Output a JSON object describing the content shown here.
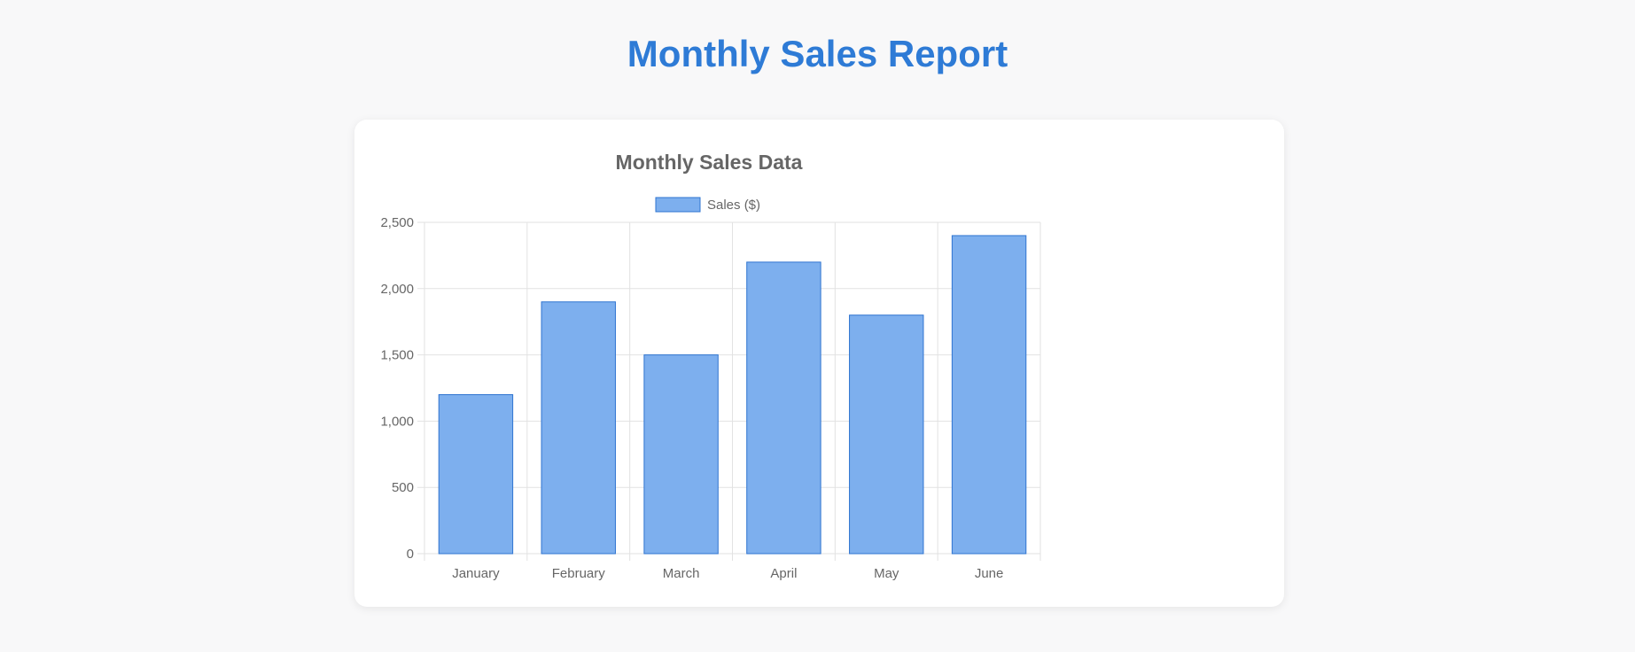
{
  "page": {
    "title": "Monthly Sales Report"
  },
  "colors": {
    "title": "#2e7bd6",
    "bar_fill": "#7dafee",
    "bar_border": "#2f74d0",
    "grid": "#e2e2e2",
    "text": "#666666"
  },
  "chart_data": {
    "type": "bar",
    "title": "Monthly Sales Data",
    "categories": [
      "January",
      "February",
      "March",
      "April",
      "May",
      "June"
    ],
    "series": [
      {
        "name": "Sales ($)",
        "values": [
          1200,
          1900,
          1500,
          2200,
          1800,
          2400
        ]
      }
    ],
    "ylim": [
      0,
      2500
    ],
    "yticks": [
      "0",
      "500",
      "1,000",
      "1,500",
      "2,000",
      "2,500"
    ],
    "legend": "top",
    "grid": true
  }
}
